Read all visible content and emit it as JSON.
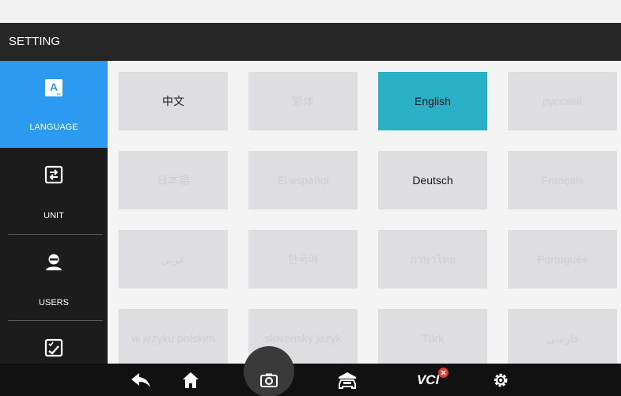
{
  "header": {
    "title": "SETTING"
  },
  "sidebar": {
    "items": [
      {
        "label": "LANGUAGE",
        "icon": "language-icon",
        "active": true
      },
      {
        "label": "UNIT",
        "icon": "unit-icon",
        "active": false
      },
      {
        "label": "USERS",
        "icon": "user-icon",
        "active": false
      },
      {
        "label": "",
        "icon": "checklist-icon",
        "active": false
      }
    ]
  },
  "languages": [
    {
      "label": "中文",
      "state": "enabled"
    },
    {
      "label": "繁体",
      "state": "disabled"
    },
    {
      "label": "English",
      "state": "selected"
    },
    {
      "label": "русский",
      "state": "disabled"
    },
    {
      "label": "日本語",
      "state": "disabled"
    },
    {
      "label": "El español",
      "state": "disabled"
    },
    {
      "label": "Deutsch",
      "state": "enabled"
    },
    {
      "label": "Français",
      "state": "disabled"
    },
    {
      "label": "عربي",
      "state": "disabled"
    },
    {
      "label": "한국어",
      "state": "disabled"
    },
    {
      "label": "ภาษาไทย",
      "state": "disabled"
    },
    {
      "label": "Português",
      "state": "disabled"
    },
    {
      "label": "w języku polskim",
      "state": "disabled"
    },
    {
      "label": "slovenský jazyk",
      "state": "disabled"
    },
    {
      "label": "Türk",
      "state": "disabled"
    },
    {
      "label": "فارسی",
      "state": "disabled"
    }
  ],
  "navbar": {
    "vci_label": "VCI",
    "items": [
      "back-icon",
      "home-icon",
      "camera-icon",
      "car-icon",
      "vci-icon",
      "settings-icon"
    ]
  },
  "colors": {
    "accent_selected": "#2ab0c7",
    "sidebar_active": "#2c9af0",
    "vci_error": "#e83a2f"
  }
}
